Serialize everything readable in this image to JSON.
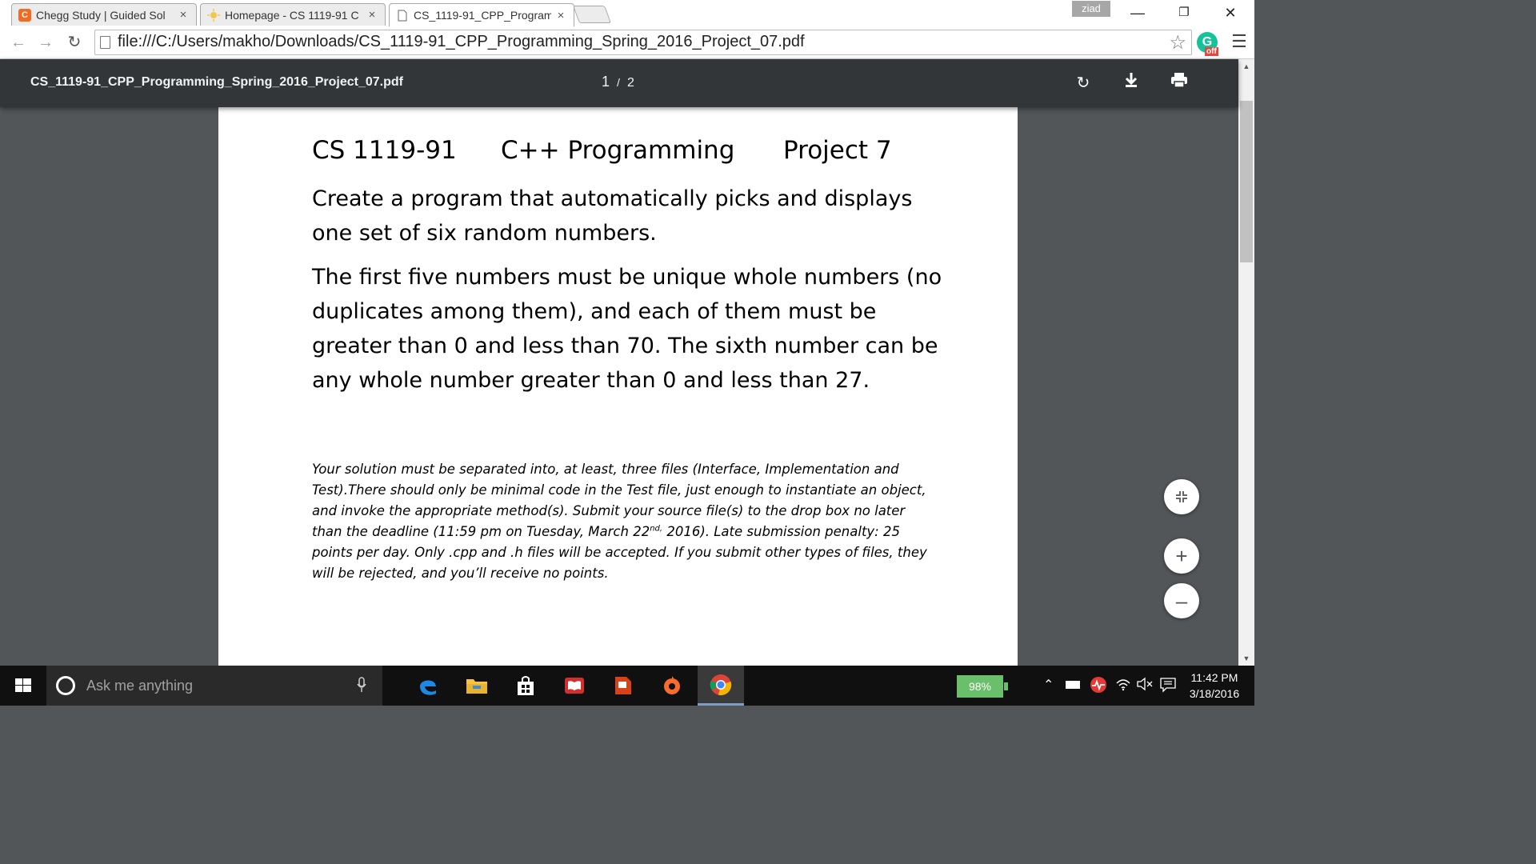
{
  "browser": {
    "tabs": [
      {
        "title": "Chegg Study | Guided Sol",
        "close": "×",
        "favicon": "C",
        "active": false
      },
      {
        "title": "Homepage - CS 1119-91 C",
        "close": "×",
        "favicon": "",
        "active": false
      },
      {
        "title": "CS_1119-91_CPP_Program",
        "close": "×",
        "favicon": "",
        "active": true
      }
    ],
    "profile_name": "ziad",
    "url": "file:///C:/Users/makho/Downloads/CS_1119-91_CPP_Programming_Spring_2016_Project_07.pdf",
    "extension_badge": "off",
    "extension_letter": "G"
  },
  "pdf_viewer": {
    "file_name": "CS_1119-91_CPP_Programming_Spring_2016_Project_07.pdf",
    "current_page": "1",
    "page_separator": "/",
    "total_pages": "2"
  },
  "document": {
    "course_code": "CS 1119-91",
    "course_name": "C++ Programming",
    "project": "Project 7",
    "paragraph1": "Create a program that automatically picks and displays one set of six random numbers.",
    "paragraph2": "The first five numbers must be unique whole numbers (no duplicates among them), and each of them must be greater than 0 and less than 70. The sixth number can be any whole number greater than 0 and less than 27.",
    "note_before_sup": "Your solution must be separated into, at least, three files (Interface, Implementation and Test).There should only be minimal code in the Test file, just enough to instantiate an object, and invoke the appropriate method(s). Submit your source file(s) to the drop box no later than the deadline (11:59 pm on Tuesday, March 22",
    "note_sup": "nd,",
    "note_after_sup": " 2016). Late submission penalty: 25 points per day. Only .cpp and .h files will be accepted. If you submit other types of files, they will be rejected, and you’ll receive no points."
  },
  "taskbar": {
    "search_placeholder": "Ask me anything",
    "battery": "98%",
    "time": "11:42 PM",
    "date": "3/18/2016"
  },
  "colors": {
    "pdf_toolbar": "#323639",
    "viewer_background": "#525659",
    "taskbar": "#101010",
    "battery": "#6ac06a"
  }
}
